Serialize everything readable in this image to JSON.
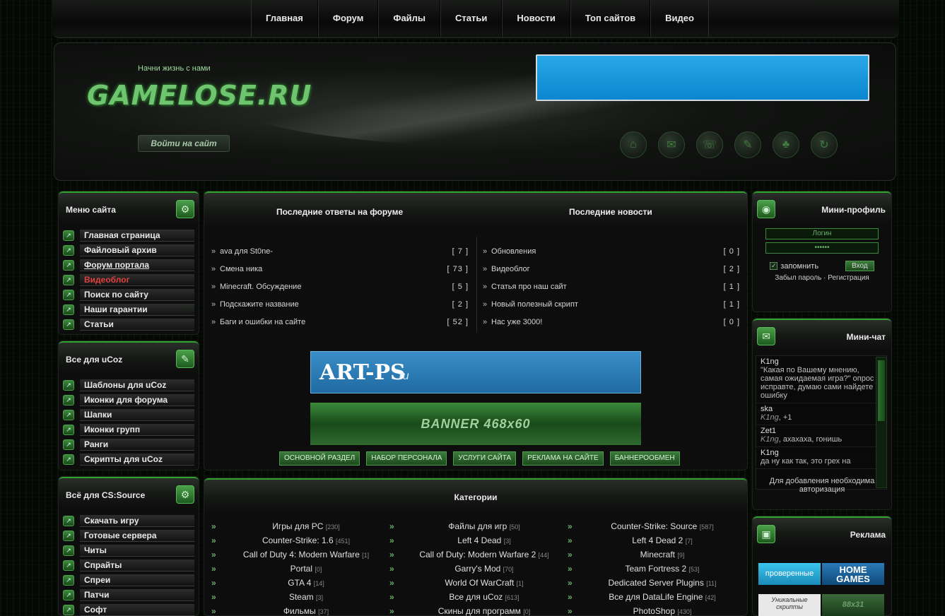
{
  "nav": [
    "Главная",
    "Форум",
    "Файлы",
    "Статьи",
    "Новости",
    "Топ сайтов",
    "Видео"
  ],
  "header": {
    "slogan": "Начни жизнь с нами",
    "logo": "GAMELOSE.RU",
    "login_button": "Войти на сайт",
    "icons": [
      "home-icon",
      "chat-icon",
      "phone-icon",
      "palette-icon",
      "gamepad-icon",
      "refresh-icon"
    ]
  },
  "site_menu": {
    "title": "Меню сайта",
    "items": [
      "Главная страница",
      "Файловый архив",
      "Форум портала",
      "Видеоблог",
      "Поиск по сайту",
      "Наши гарантии",
      "Статьи"
    ]
  },
  "ucoz_menu": {
    "title": "Все для uCoz",
    "items": [
      "Шаблоны для uCoz",
      "Иконки для форума",
      "Шапки",
      "Иконки групп",
      "Ранги",
      "Скрипты для uCoz"
    ]
  },
  "css_menu": {
    "title": "Всё для CS:Source",
    "items": [
      "Скачать игру",
      "Готовые сервера",
      "Читы",
      "Спрайты",
      "Спреи",
      "Патчи",
      "Софт"
    ]
  },
  "center": {
    "forum_title": "Последние ответы на форуме",
    "news_title": "Последние новости",
    "forum": [
      {
        "title": "ava для St0ne-",
        "count": "[ 7 ]"
      },
      {
        "title": "Смена ника",
        "count": "[ 73 ]"
      },
      {
        "title": "Minecraft. Обсуждение",
        "count": "[ 5 ]"
      },
      {
        "title": "Подскажите название",
        "count": "[ 2 ]"
      },
      {
        "title": "Баги и ошибки на сайте",
        "count": "[ 52 ]"
      }
    ],
    "news": [
      {
        "title": "Обновления",
        "count": "[ 0 ]"
      },
      {
        "title": "Видеоблог",
        "count": "[ 2 ]"
      },
      {
        "title": "Статья про наш сайт",
        "count": "[ 1 ]"
      },
      {
        "title": "Новый полезный скрипт",
        "count": "[ 1 ]"
      },
      {
        "title": "Нас уже 3000!",
        "count": "[ 0 ]"
      }
    ],
    "artps_title": "ART-PS",
    "artps_domain": ".ru",
    "banner_text": "BANNER 468x60",
    "buttons": [
      "ОСНОВНОЙ РАЗДЕЛ",
      "НАБОР ПЕРСОНАЛА",
      "УСЛУГИ САЙТА",
      "РЕКЛАМА НА САЙТЕ",
      "БАННЕРООБМЕН"
    ]
  },
  "categories": {
    "title": "Категории",
    "cols": [
      [
        {
          "name": "Игры для PC",
          "n": "[230]"
        },
        {
          "name": "Counter-Strike: 1.6",
          "n": "[451]"
        },
        {
          "name": "Call of Duty 4: Modern Warfare",
          "n": "[1]"
        },
        {
          "name": "Portal",
          "n": "[0]"
        },
        {
          "name": "GTA 4",
          "n": "[14]"
        },
        {
          "name": "Steam",
          "n": "[3]"
        },
        {
          "name": "Фильмы",
          "n": "[37]"
        }
      ],
      [
        {
          "name": "Файлы для игр",
          "n": "[50]"
        },
        {
          "name": "Left 4 Dead",
          "n": "[3]"
        },
        {
          "name": "Call of Duty: Modern Warfare 2",
          "n": "[44]"
        },
        {
          "name": "Garry's Mod",
          "n": "[70]"
        },
        {
          "name": "World Of WarCraft",
          "n": "[1]"
        },
        {
          "name": "Все для uCoz",
          "n": "[613]"
        },
        {
          "name": "Скины для программ",
          "n": "[0]"
        }
      ],
      [
        {
          "name": "Counter-Strike: Source",
          "n": "[587]"
        },
        {
          "name": "Left 4 Dead 2",
          "n": "[7]"
        },
        {
          "name": "Minecraft",
          "n": "[9]"
        },
        {
          "name": "Team Fortress 2",
          "n": "[53]"
        },
        {
          "name": "Dedicated Server Plugins",
          "n": "[11]"
        },
        {
          "name": "Все для DataLife Engine",
          "n": "[42]"
        },
        {
          "name": "PhotoShop",
          "n": "[430]"
        }
      ]
    ]
  },
  "mini_profile": {
    "title": "Мини-профиль",
    "login_placeholder": "Логин",
    "password_placeholder": "••••••",
    "remember": "запомнить",
    "enter": "Вход",
    "forgot": "Забыл пароль",
    "sep": "·",
    "register": "Регистрация"
  },
  "mini_chat": {
    "title": "Мини-чат",
    "messages": [
      {
        "user": "K1ng",
        "text": "\"Какая по Вашему мнению, самая ожидаемая игра?\" опрос исправте, думаю сами найдете ошибку",
        "to": ""
      },
      {
        "user": "ska",
        "to": "K1ng",
        "text": ", +1"
      },
      {
        "user": "Zet1",
        "to": "K1ng",
        "text": ", ахахаха, гонишь"
      },
      {
        "user": "K1ng",
        "to": "",
        "text": "да ну как так, это грех на"
      }
    ],
    "note": "Для добавления необходима авторизация"
  },
  "ads": {
    "title": "Реклама",
    "b1": "проверенные",
    "b2": "HOME GAMES",
    "b3": "Уникальные скрипты",
    "b4": "88x31"
  }
}
